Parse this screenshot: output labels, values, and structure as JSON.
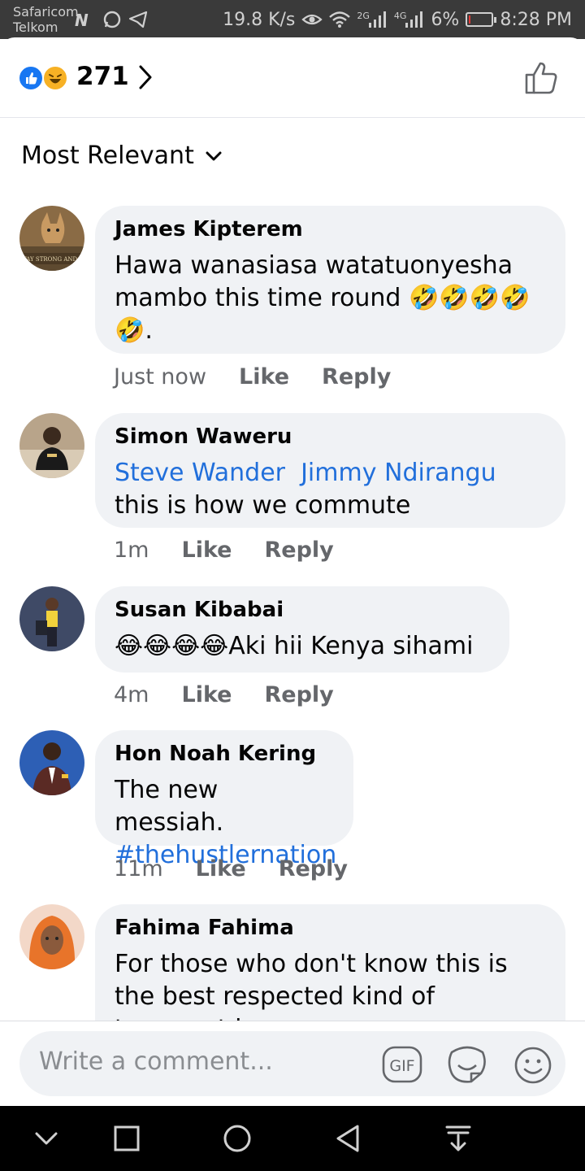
{
  "status_bar": {
    "carrier_line1": "Safaricom",
    "carrier_line2": "Telkom",
    "net_speed": "19.8 K/s",
    "net_2g": "2G",
    "net_4g": "4G",
    "battery": "6%",
    "battery_level": 0.06,
    "time": "8:28 PM"
  },
  "reactions": {
    "count": "271",
    "icons": [
      "like-icon",
      "haha-icon"
    ]
  },
  "sort": {
    "label": "Most Relevant"
  },
  "comments": [
    {
      "author": "James Kipterem",
      "text": "Hawa wanasiasa watatuonyesha mambo this time round",
      "emojis_after": "🤣🤣🤣🤣🤣.",
      "time": "Just now",
      "like": "Like",
      "reply": "Reply"
    },
    {
      "author": "Simon Waweru",
      "mention1": "Steve Wander",
      "mention2": "Jimmy Ndirangu",
      "text": "this is how we commute",
      "time": "1m",
      "like": "Like",
      "reply": "Reply"
    },
    {
      "author": "Susan Kibabai",
      "emojis_before": "😂😂😂😂",
      "text": "Aki hii Kenya sihami",
      "time": "4m",
      "like": "Like",
      "reply": "Reply"
    },
    {
      "author": "Hon Noah Kering",
      "text": "The new messiah.",
      "hashtag": "#thehustlernation",
      "time": "11m",
      "like": "Like",
      "reply": "Reply"
    },
    {
      "author": "Fahima Fahima",
      "text": "For those who don't know this is the best respected kind of transport in"
    }
  ],
  "composer": {
    "placeholder": "Write a comment...",
    "gif_label": "GIF"
  },
  "colors": {
    "accent_blue": "#1877f2",
    "link_blue": "#216fdb",
    "bubble_bg": "#f0f2f5",
    "meta_gray": "#65676b"
  }
}
